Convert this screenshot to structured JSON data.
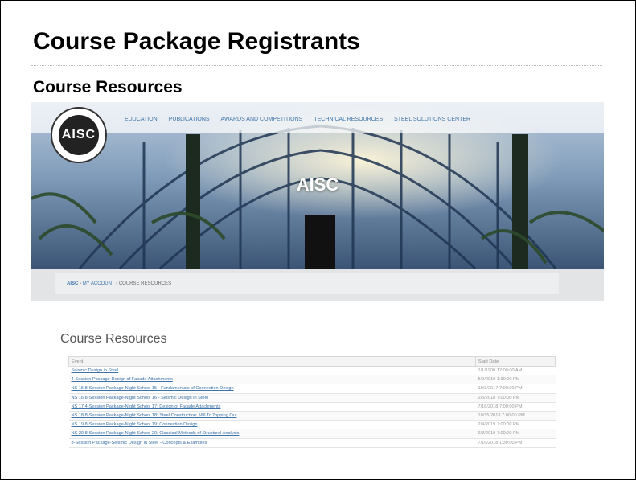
{
  "slide": {
    "title": "Course Package Registrants",
    "subtitle": "Course Resources"
  },
  "site": {
    "logo_text": "AISC",
    "hero_title": "AISC",
    "nav": [
      "EDUCATION",
      "PUBLICATIONS",
      "AWARDS AND COMPETITIONS",
      "TECHNICAL RESOURCES",
      "STEEL SOLUTIONS CENTER"
    ],
    "breadcrumb": {
      "home": "AISC",
      "account": "MY ACCOUNT",
      "current": "COURSE RESOURCES",
      "sep": "›"
    }
  },
  "resources": {
    "heading": "Course Resources",
    "columns": [
      "Event",
      "Start Date"
    ],
    "rows": [
      {
        "event": "Seismic Design in Steel",
        "date": "1/1/1900 12:00:00 AM"
      },
      {
        "event": "4-Session Package-Design of Facade Attachments",
        "date": "5/9/2019 1:30:00 PM"
      },
      {
        "event": "NS 15 8-Session Package-Night School 15 - Fundamentals of Connection Design",
        "date": "10/3/2017 7:00:00 PM"
      },
      {
        "event": "NS 16 8-Session Package-Night School 16 - Seismic Design in Steel",
        "date": "2/5/2018 7:00:00 PM"
      },
      {
        "event": "NS 17 4-Session Package-Night School 17: Design of Facade Attachments",
        "date": "7/16/2018 7:00:00 PM"
      },
      {
        "event": "NS 18 8-Session Package-Night School 18: Steel Construction: Mill To Topping Out",
        "date": "10/15/2018 7:00:00 PM"
      },
      {
        "event": "NS 19 8-Session Package-Night School 19: Connection Design",
        "date": "2/4/2019 7:00:00 PM"
      },
      {
        "event": "NS 20 8-Session Package-Night School 20: Classical Methods of Structural Analysis",
        "date": "6/3/2019 7:00:00 PM"
      },
      {
        "event": "8-Session Package-Seismic Design in Steel - Concepts & Examples",
        "date": "7/16/2018 1:30:00 PM"
      }
    ]
  },
  "colors": {
    "link": "#3d73a8",
    "hero_sky": "#7f9bb9"
  }
}
